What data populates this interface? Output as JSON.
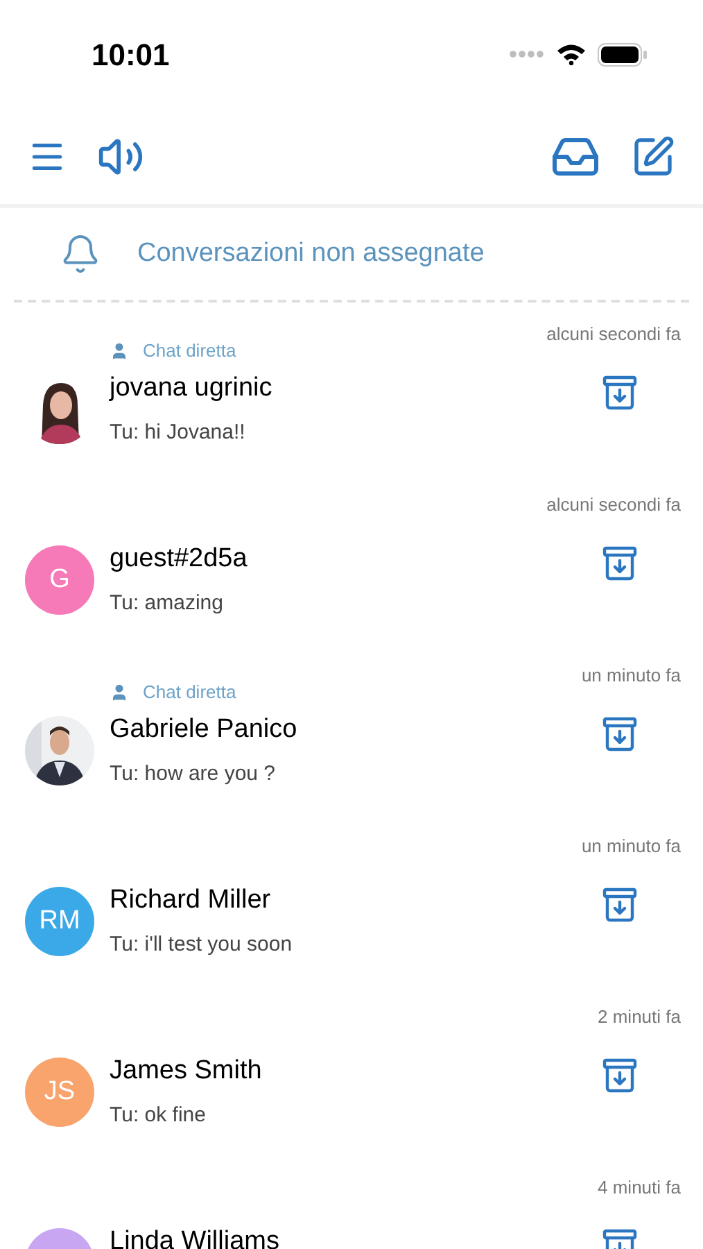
{
  "status_bar": {
    "time": "10:01"
  },
  "banner": {
    "label": "Conversazioni non assegnate"
  },
  "conversations": [
    {
      "time": "alcuni secondi fa",
      "tag": "Chat diretta",
      "name": "jovana ugrinic",
      "preview": "Tu: hi Jovana!!"
    },
    {
      "kind": "initials",
      "initials": "G",
      "color": "#f77ab8",
      "time": "alcuni secondi fa",
      "name": "guest#2d5a",
      "preview": "Tu: amazing"
    },
    {
      "time": "un minuto fa",
      "tag": "Chat diretta",
      "name": "Gabriele Panico",
      "preview": "Tu: how are you ?"
    },
    {
      "kind": "initials",
      "initials": "RM",
      "color": "#3ba9e8",
      "time": "un minuto fa",
      "name": "Richard Miller",
      "preview": "Tu: i'll test you soon"
    },
    {
      "kind": "initials",
      "initials": "JS",
      "color": "#f8a46c",
      "time": "2 minuti fa",
      "name": "James Smith",
      "preview": "Tu: ok fine"
    },
    {
      "kind": "initials",
      "color": "#c8a6f2",
      "time": "4 minuti fa",
      "name": "Linda Williams"
    }
  ]
}
